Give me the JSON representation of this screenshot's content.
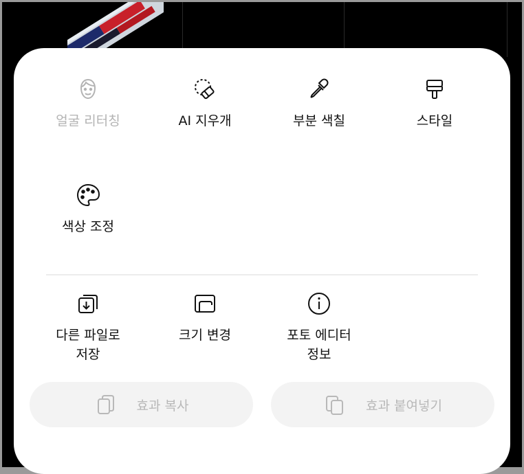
{
  "background_overlay": {
    "color": "#000000"
  },
  "menu": {
    "row1": [
      {
        "label": "얼굴 리터칭",
        "icon": "face-icon",
        "enabled": false
      },
      {
        "label": "AI 지우개",
        "icon": "ai-eraser-icon",
        "enabled": true
      },
      {
        "label": "부분 색칠",
        "icon": "eyedropper-icon",
        "enabled": true
      },
      {
        "label": "스타일",
        "icon": "paint-roller-icon",
        "enabled": true
      }
    ],
    "row2": [
      {
        "label": "색상 조정",
        "icon": "palette-icon",
        "enabled": true
      }
    ],
    "row3": [
      {
        "label": "다른 파일로 저장",
        "icon": "save-as-icon",
        "enabled": true
      },
      {
        "label": "크기 변경",
        "icon": "resize-icon",
        "enabled": true
      },
      {
        "label": "포토 에디터 정보",
        "icon": "info-icon",
        "enabled": true
      }
    ]
  },
  "actions": {
    "copy_effect": {
      "label": "효과 복사",
      "icon": "copy-icon",
      "enabled": false
    },
    "paste_effect": {
      "label": "효과 붙여넣기",
      "icon": "paste-icon",
      "enabled": false
    }
  },
  "colors": {
    "sheet": "#ffffff",
    "disabled_text": "#b3b3b3",
    "text": "#111111",
    "pill_bg": "#f3f3f3"
  }
}
